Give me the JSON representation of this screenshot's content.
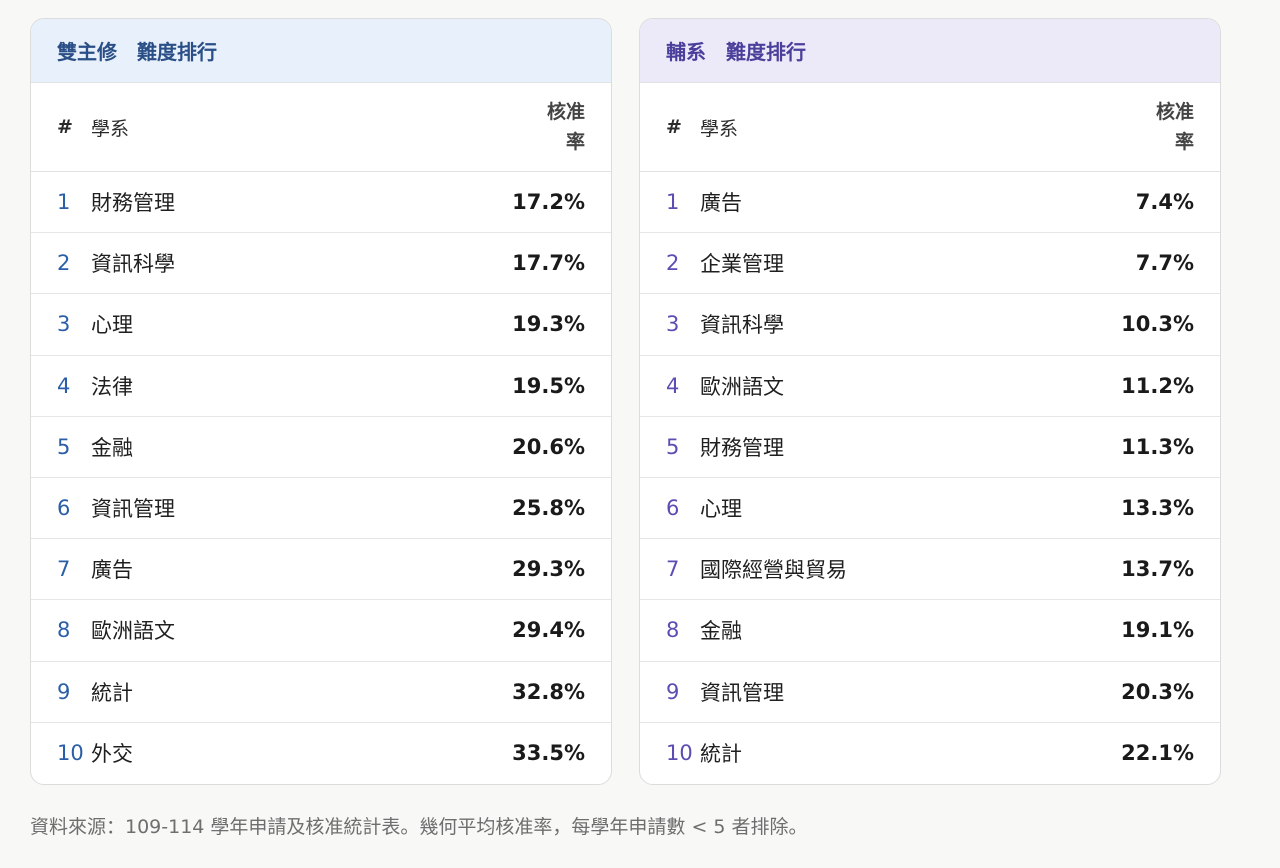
{
  "double_major": {
    "title_a": "雙主修",
    "title_b": "難度排行",
    "col_rank": "#",
    "col_name": "學系",
    "col_rate_line1": "核准",
    "col_rate_line2": "率",
    "rows": [
      {
        "rank": "1",
        "name": "財務管理",
        "rate": "17.2%"
      },
      {
        "rank": "2",
        "name": "資訊科學",
        "rate": "17.7%"
      },
      {
        "rank": "3",
        "name": "心理",
        "rate": "19.3%"
      },
      {
        "rank": "4",
        "name": "法律",
        "rate": "19.5%"
      },
      {
        "rank": "5",
        "name": "金融",
        "rate": "20.6%"
      },
      {
        "rank": "6",
        "name": "資訊管理",
        "rate": "25.8%"
      },
      {
        "rank": "7",
        "name": "廣告",
        "rate": "29.3%"
      },
      {
        "rank": "8",
        "name": "歐洲語文",
        "rate": "29.4%"
      },
      {
        "rank": "9",
        "name": "統計",
        "rate": "32.8%"
      },
      {
        "rank": "10",
        "name": "外交",
        "rate": "33.5%"
      }
    ]
  },
  "minor": {
    "title_a": "輔系",
    "title_b": "難度排行",
    "col_rank": "#",
    "col_name": "學系",
    "col_rate_line1": "核准",
    "col_rate_line2": "率",
    "rows": [
      {
        "rank": "1",
        "name": "廣告",
        "rate": "7.4%"
      },
      {
        "rank": "2",
        "name": "企業管理",
        "rate": "7.7%"
      },
      {
        "rank": "3",
        "name": "資訊科學",
        "rate": "10.3%"
      },
      {
        "rank": "4",
        "name": "歐洲語文",
        "rate": "11.2%"
      },
      {
        "rank": "5",
        "name": "財務管理",
        "rate": "11.3%"
      },
      {
        "rank": "6",
        "name": "心理",
        "rate": "13.3%"
      },
      {
        "rank": "7",
        "name": "國際經營與貿易",
        "rate": "13.7%"
      },
      {
        "rank": "8",
        "name": "金融",
        "rate": "19.1%"
      },
      {
        "rank": "9",
        "name": "資訊管理",
        "rate": "20.3%"
      },
      {
        "rank": "10",
        "name": "統計",
        "rate": "22.1%"
      }
    ]
  },
  "footnote": "資料來源：109-114 學年申請及核准統計表。幾何平均核准率，每學年申請數 < 5 者排除。",
  "colors": {
    "blue_header_bg": "#e8f0fb",
    "blue_accent": "#2a5ea8",
    "purple_header_bg": "#eceaf9",
    "purple_accent": "#5b4db3"
  }
}
